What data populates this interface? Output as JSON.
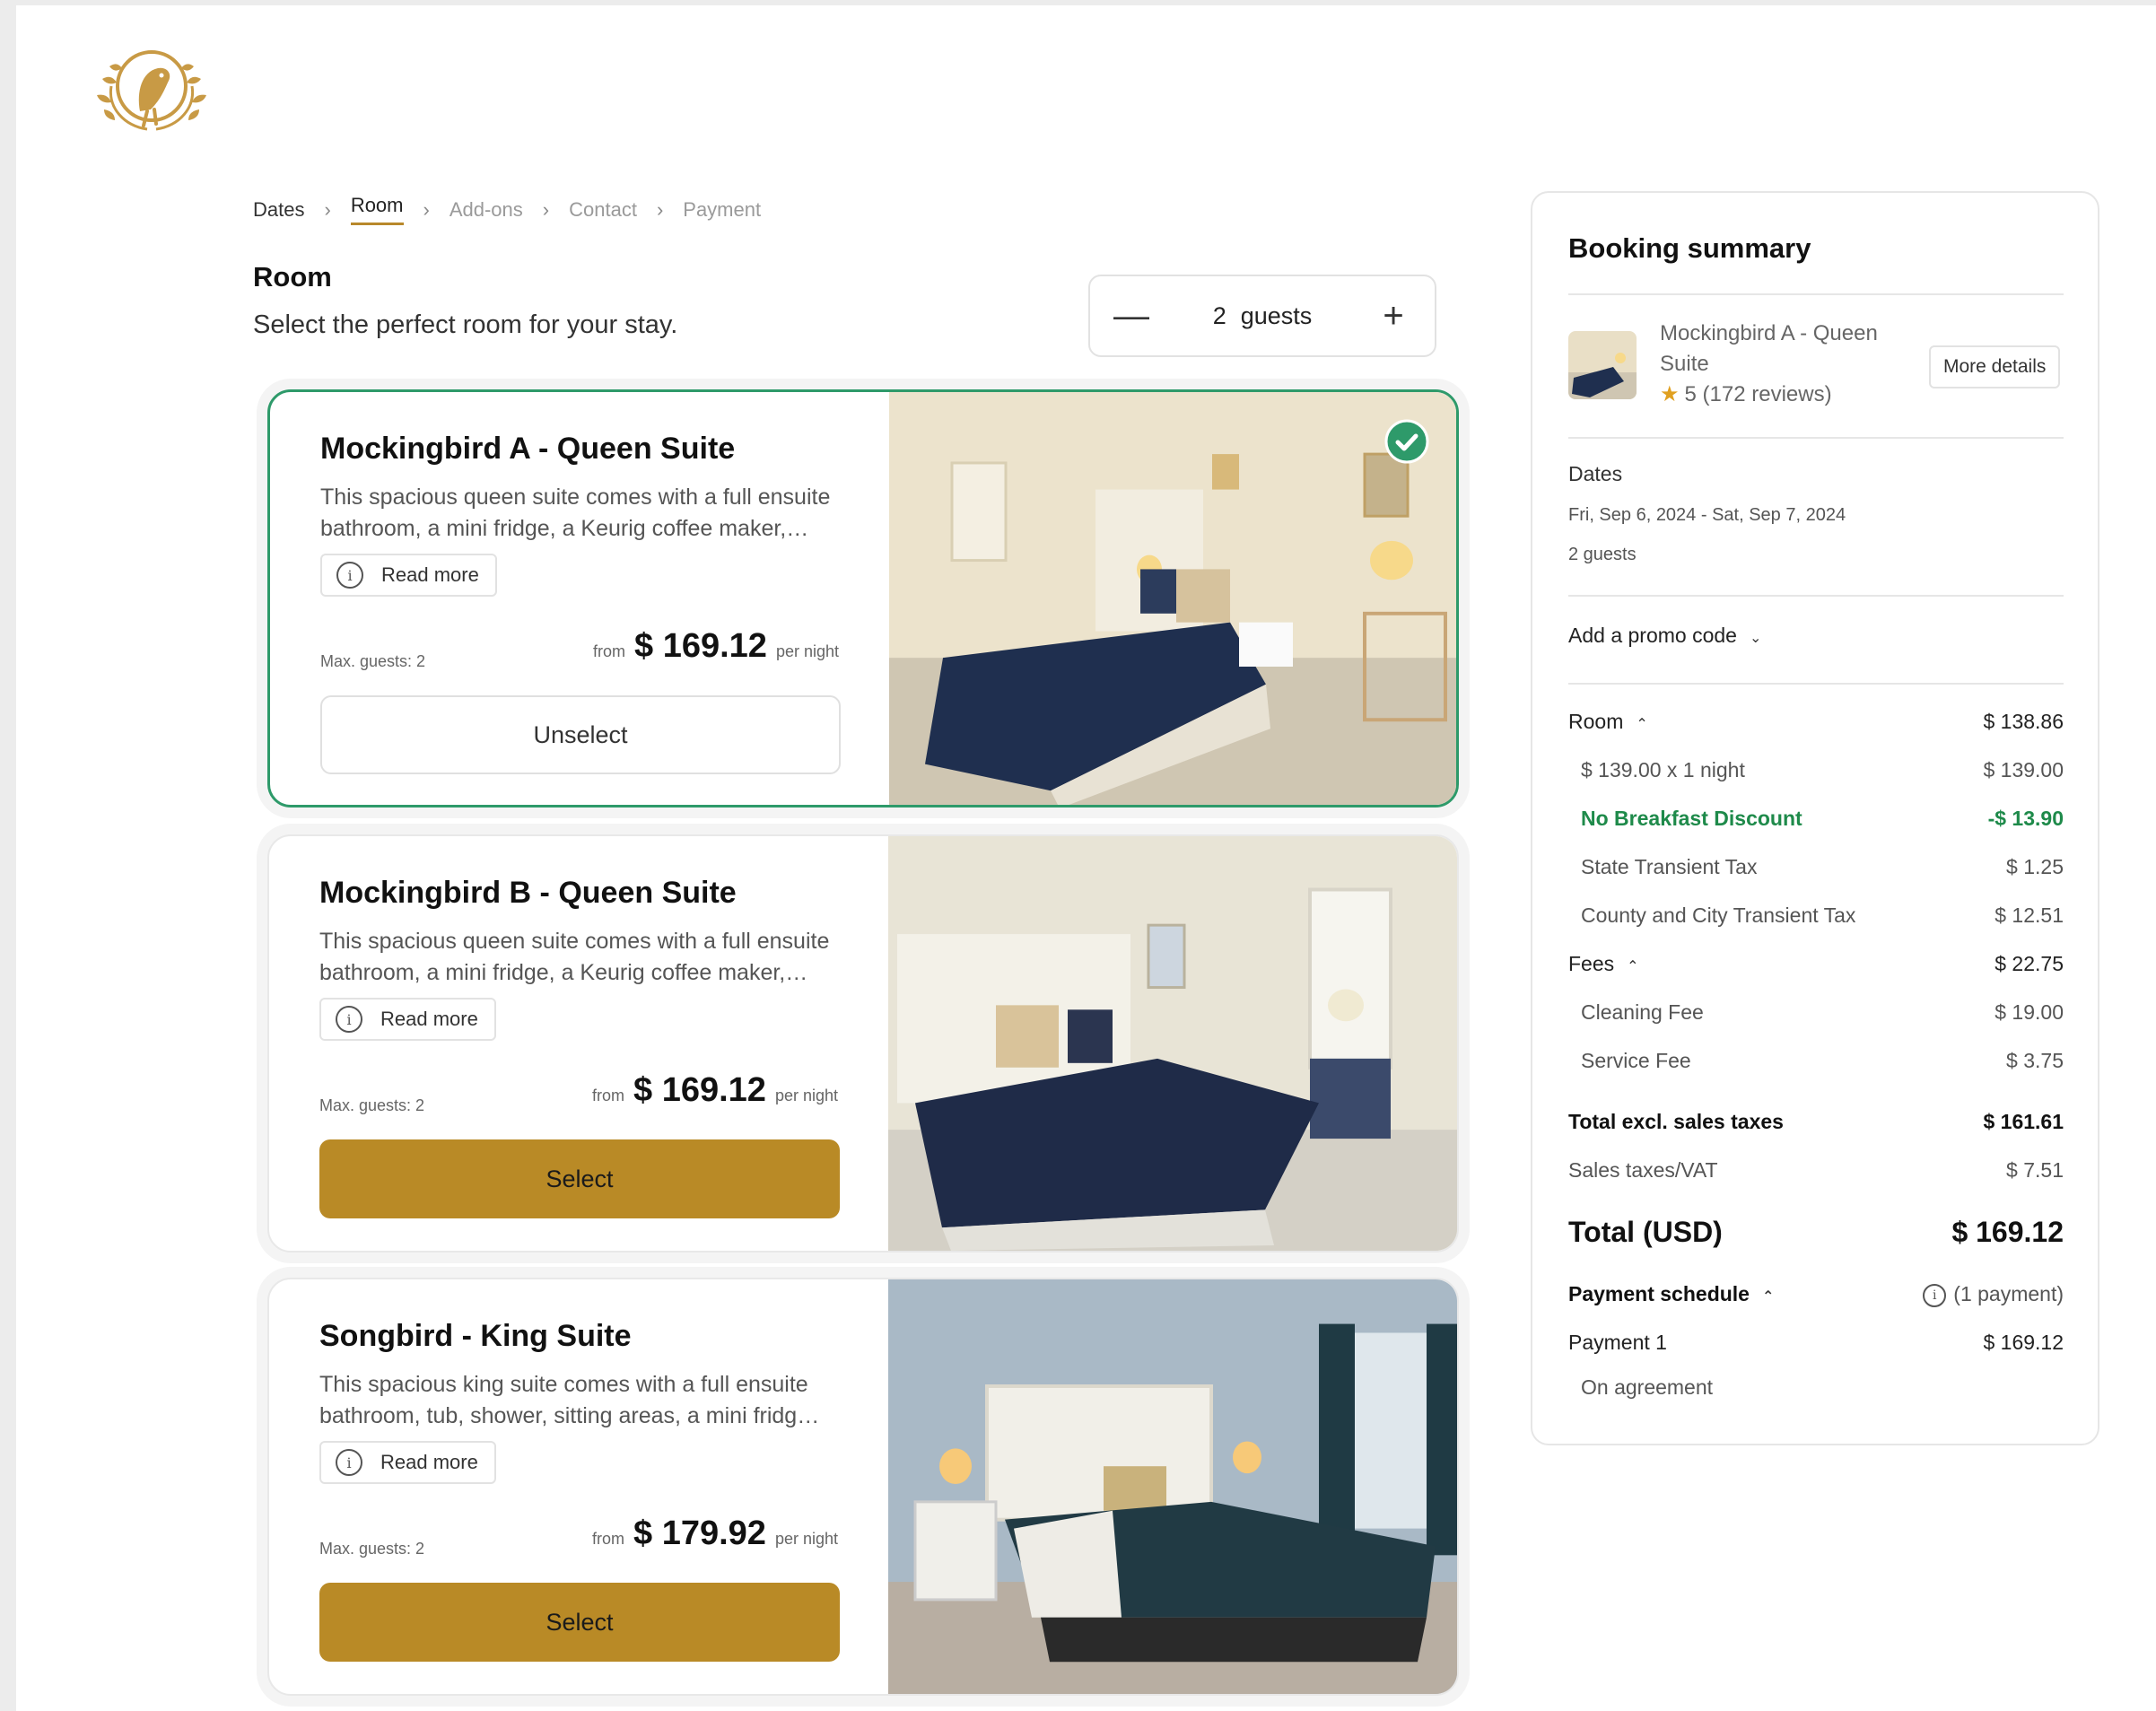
{
  "breadcrumb": {
    "steps": [
      "Dates",
      "Room",
      "Add-ons",
      "Contact",
      "Payment"
    ],
    "separator": "›"
  },
  "header": {
    "title": "Room",
    "subtitle": "Select the perfect room for your stay."
  },
  "guests": {
    "minus": "—",
    "count": "2",
    "unit": "guests",
    "plus": "+"
  },
  "rooms": [
    {
      "name": "Mockingbird A - Queen Suite",
      "description": "This spacious queen suite comes with a full ensuite bathroom, a mini fridge, a Keurig coffee maker,…",
      "read_more": "Read more",
      "max_guests": "Max. guests: 2",
      "from": "from",
      "price": "$ 169.12",
      "per": "per night",
      "button": "Unselect",
      "selected": true
    },
    {
      "name": "Mockingbird B - Queen Suite",
      "description": "This spacious queen suite comes with a full ensuite bathroom, a mini fridge, a Keurig coffee maker,…",
      "read_more": "Read more",
      "max_guests": "Max. guests: 2",
      "from": "from",
      "price": "$ 169.12",
      "per": "per night",
      "button": "Select",
      "selected": false
    },
    {
      "name": "Songbird - King Suite",
      "description": "This spacious king suite comes with a full ensuite bathroom, tub, shower, sitting areas, a mini fridg…",
      "read_more": "Read more",
      "max_guests": "Max. guests: 2",
      "from": "from",
      "price": "$ 179.92",
      "per": "per night",
      "button": "Select",
      "selected": false
    }
  ],
  "summary": {
    "title": "Booking summary",
    "room_name": "Mockingbird A - Queen Suite",
    "rating": "5 (172 reviews)",
    "more_details": "More details",
    "dates_label": "Dates",
    "dates_value": "Fri, Sep 6, 2024 - Sat, Sep 7, 2024",
    "guests_value": "2 guests",
    "promo": "Add a promo code",
    "room_label": "Room",
    "room_total": "$ 138.86",
    "nightly_label": "$ 139.00 x 1 night",
    "nightly_value": "$ 139.00",
    "discount_label": "No Breakfast Discount",
    "discount_value": "-$ 13.90",
    "state_tax_label": "State Transient Tax",
    "state_tax_value": "$ 1.25",
    "county_tax_label": "County and City Transient Tax",
    "county_tax_value": "$ 12.51",
    "fees_label": "Fees",
    "fees_total": "$ 22.75",
    "cleaning_label": "Cleaning Fee",
    "cleaning_value": "$ 19.00",
    "service_label": "Service Fee",
    "service_value": "$ 3.75",
    "excl_label": "Total excl. sales taxes",
    "excl_value": "$ 161.61",
    "vat_label": "Sales taxes/VAT",
    "vat_value": "$ 7.51",
    "total_label": "Total (USD)",
    "total_value": "$ 169.12",
    "schedule_label": "Payment schedule",
    "schedule_note": "(1 payment)",
    "payment1_label": "Payment 1",
    "payment1_value": "$ 169.12",
    "payment1_note": "On agreement"
  },
  "colors": {
    "brand_gold": "#b98a26",
    "selected_green": "#2e9a6a",
    "discount_green": "#1e8a4a"
  }
}
